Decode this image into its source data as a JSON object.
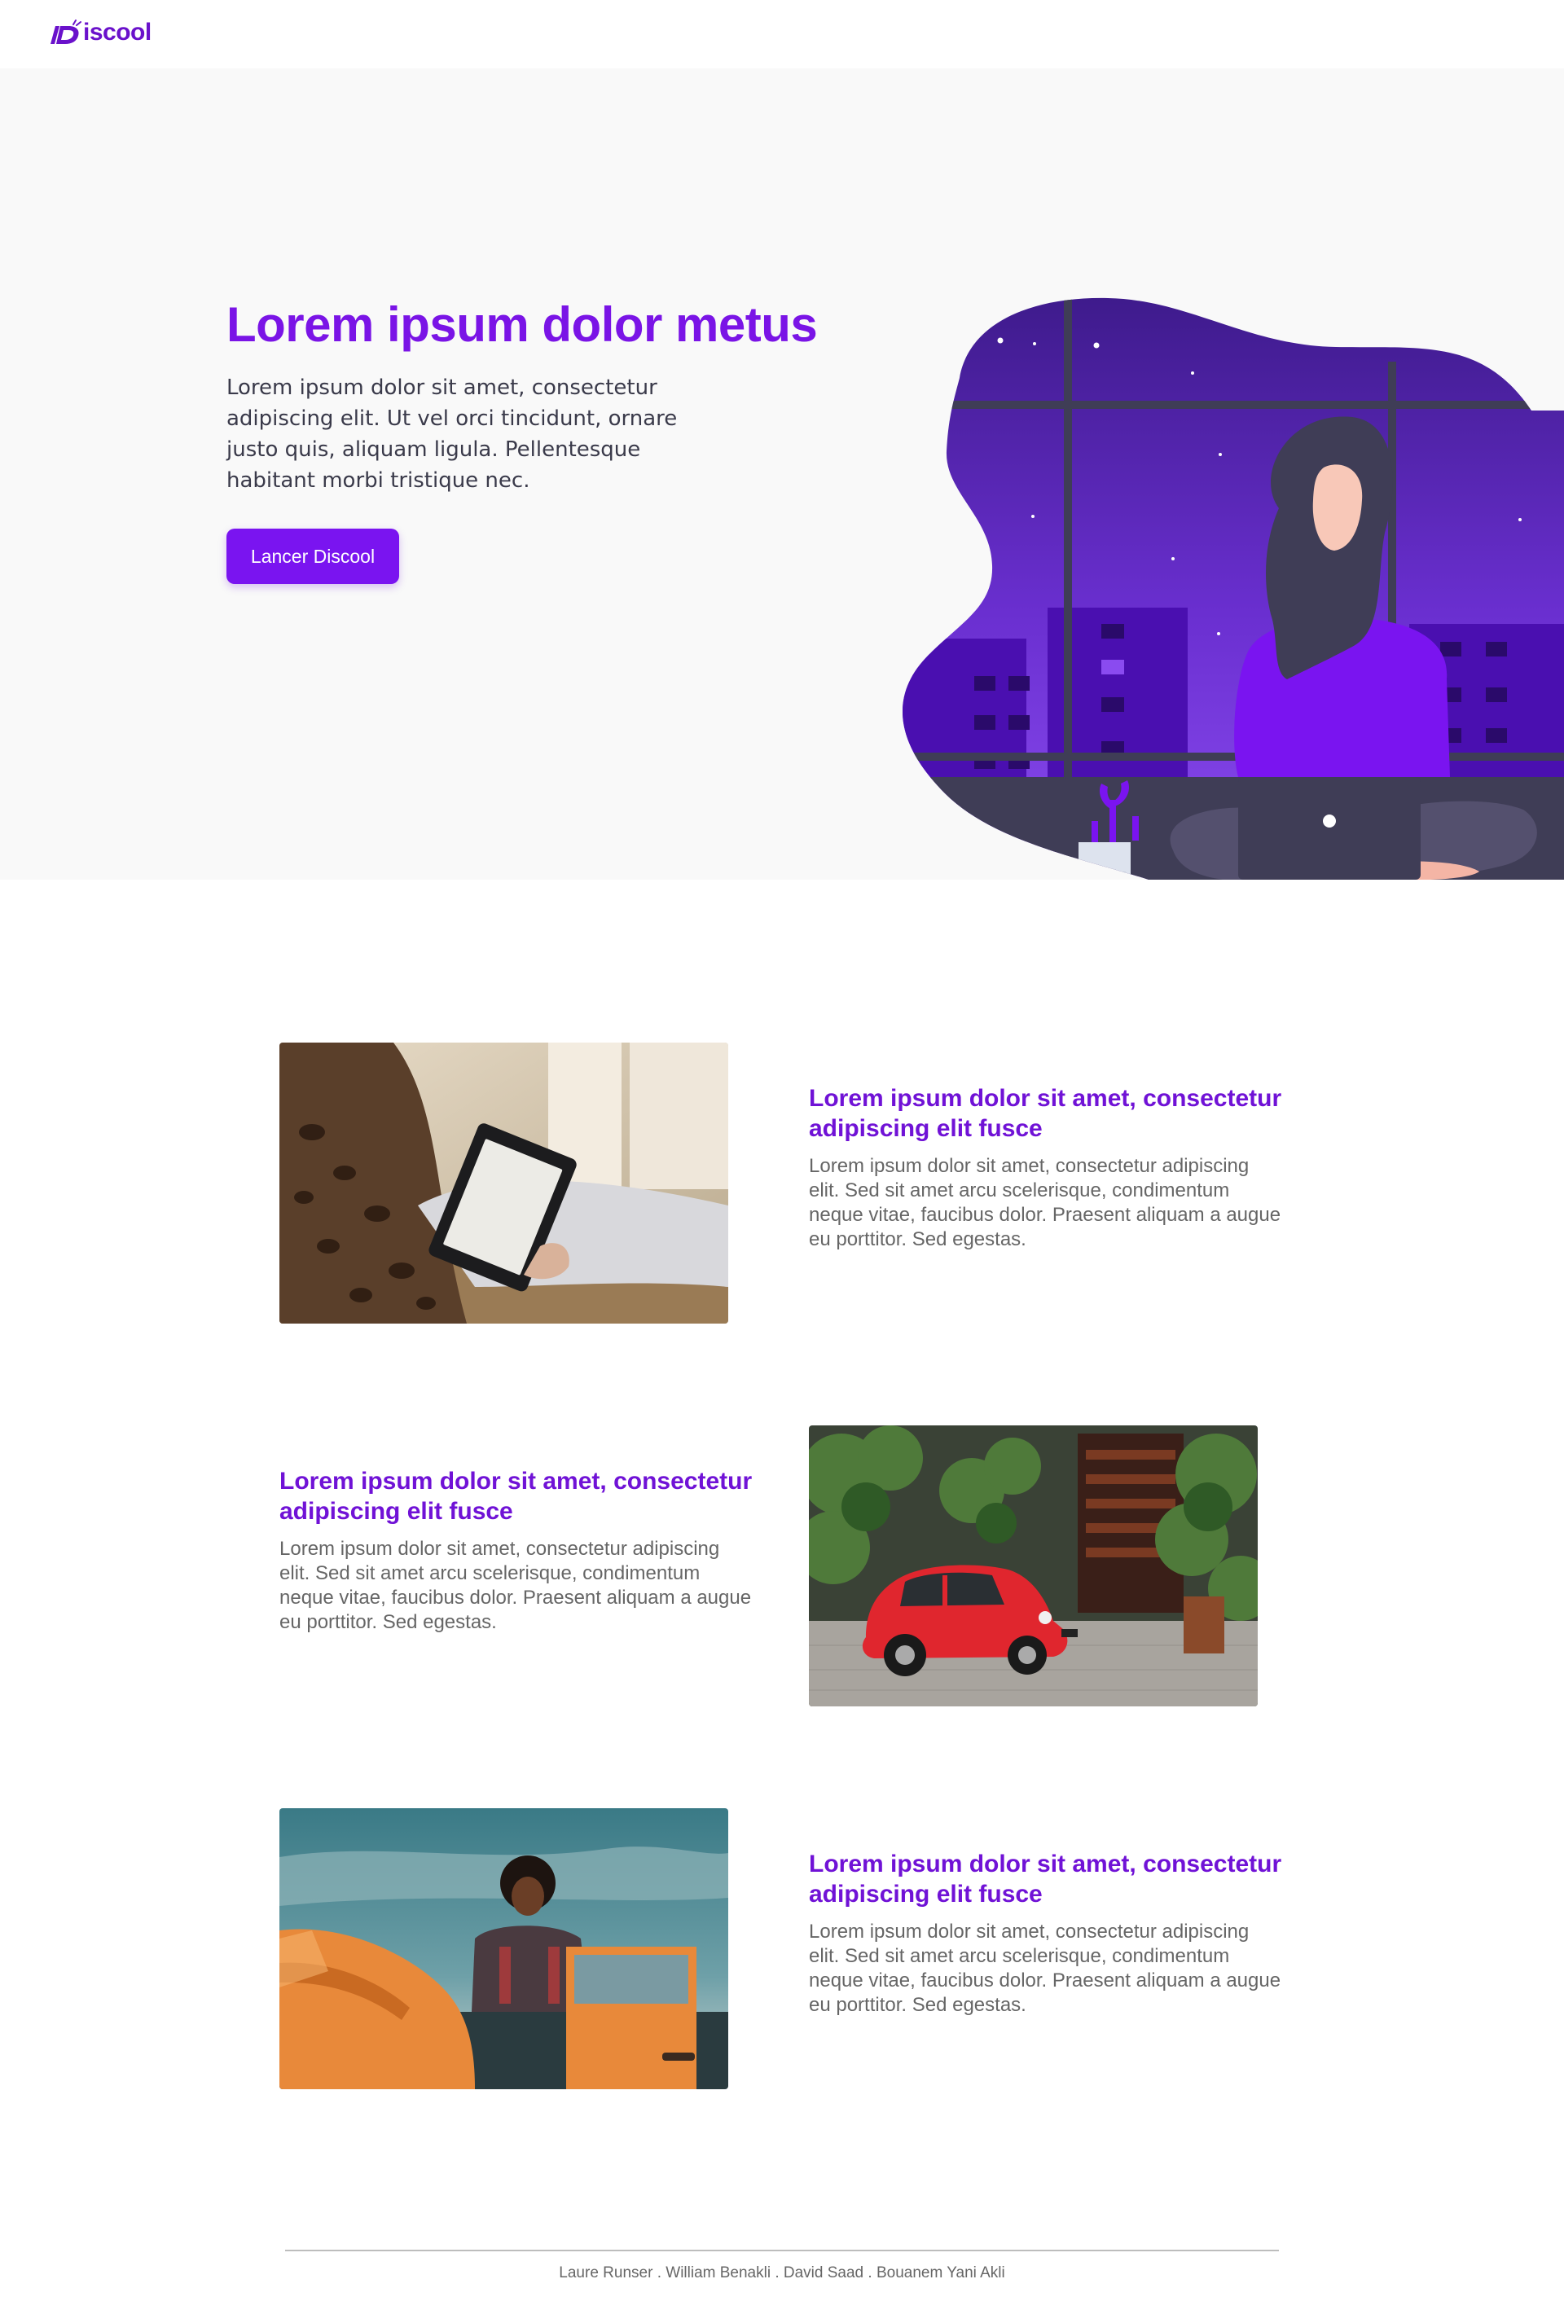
{
  "brand": {
    "name": "Discool",
    "logo_text": "iscool",
    "primary_color": "#7a14e6",
    "accent_color": "#7a14f0"
  },
  "hero": {
    "title": "Lorem ipsum dolor metus",
    "text": "Lorem ipsum dolor sit amet, consectetur adipiscing elit. Ut vel orci tincidunt, ornare justo quis, aliquam ligula. Pellentesque habitant morbi tristique nec.",
    "button_label": "Lancer Discool",
    "illustration": "woman-with-laptop-night-city-illustration"
  },
  "features": [
    {
      "title": "Lorem ipsum dolor sit amet, consectetur adipiscing elit fusce",
      "text": "Lorem ipsum dolor sit amet, consectetur adipiscing elit. Sed sit amet arcu scelerisque, condimentum neque vitae, faucibus dolor. Praesent aliquam a augue eu porttitor. Sed egestas.",
      "image": "person-reading-ebook-photo"
    },
    {
      "title": "Lorem ipsum dolor sit amet, consectetur adipiscing elit fusce",
      "text": "Lorem ipsum dolor sit amet, consectetur adipiscing elit. Sed sit amet arcu scelerisque, condimentum neque vitae, faucibus dolor. Praesent aliquam a augue eu porttitor. Sed egestas.",
      "image": "red-vintage-car-street-photo"
    },
    {
      "title": "Lorem ipsum dolor sit amet, consectetur adipiscing elit fusce",
      "text": "Lorem ipsum dolor sit amet, consectetur adipiscing elit. Sed sit amet arcu scelerisque, condimentum neque vitae, faucibus dolor. Praesent aliquam a augue eu porttitor. Sed egestas.",
      "image": "man-with-orange-car-photo"
    }
  ],
  "footer": {
    "credits": "Laure Runser . William Benakli . David Saad . Bouanem Yani Akli"
  }
}
